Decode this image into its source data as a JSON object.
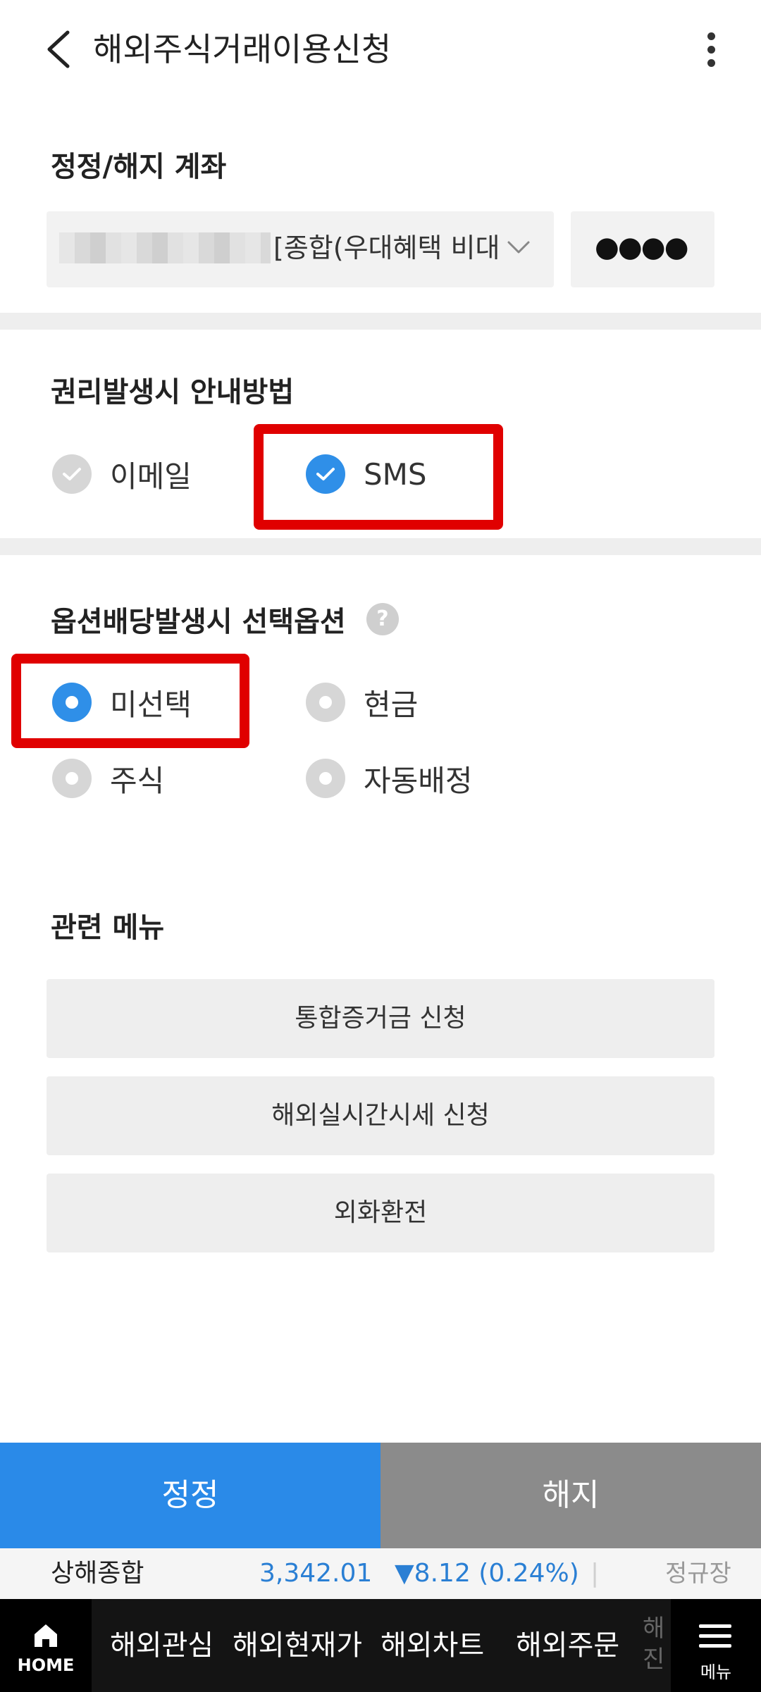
{
  "header": {
    "title": "해외주식거래이용신청"
  },
  "account_section": {
    "title": "정정/해지 계좌",
    "account_select_text": "[종합(우대혜택 비대",
    "password_mask": "●●●●"
  },
  "notify_section": {
    "title": "권리발생시 안내방법",
    "options": [
      {
        "label": "이메일",
        "checked": false
      },
      {
        "label": "SMS",
        "checked": true
      }
    ]
  },
  "option_section": {
    "title": "옵션배당발생시 선택옵션",
    "help_symbol": "?",
    "options": [
      {
        "label": "미선택",
        "selected": true
      },
      {
        "label": "현금",
        "selected": false
      },
      {
        "label": "주식",
        "selected": false
      },
      {
        "label": "자동배정",
        "selected": false
      }
    ]
  },
  "related_menu": {
    "title": "관련 메뉴",
    "items": [
      {
        "label": "통합증거금 신청"
      },
      {
        "label": "해외실시간시세 신청"
      },
      {
        "label": "외화환전"
      }
    ]
  },
  "actions": {
    "edit_label": "정정",
    "cancel_label": "해지"
  },
  "ticker": {
    "name": "상해종합",
    "value": "3,342.01",
    "change": "▼8.12 (0.24%)",
    "separator": "|",
    "status": "정규장"
  },
  "bottom_nav": {
    "home_label": "HOME",
    "tabs": [
      "해외관심",
      "해외현재가",
      "해외차트",
      "해외주문"
    ],
    "partial_tab": "해진",
    "menu_label": "메뉴"
  },
  "colors": {
    "accent_blue": "#2a8ae8",
    "highlight_red": "#e00000",
    "cancel_gray": "#8b8b8b",
    "nav_bg": "#141414"
  }
}
